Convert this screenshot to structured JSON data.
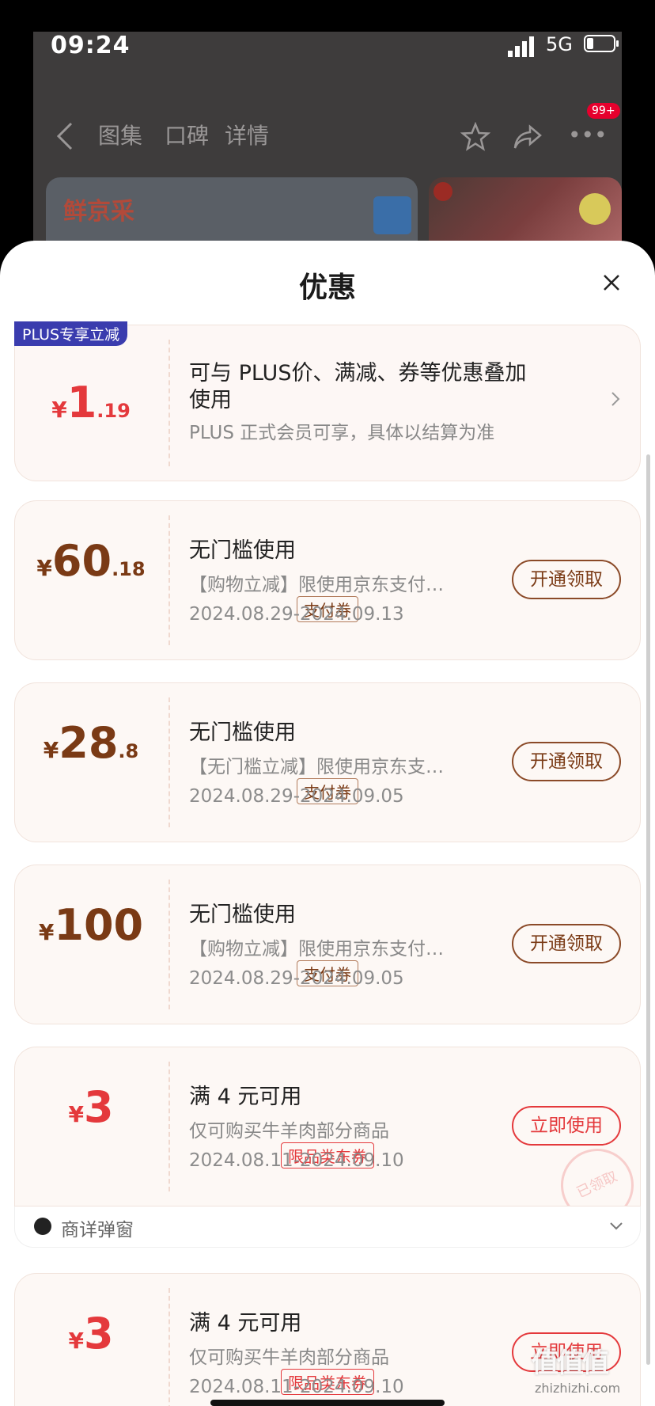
{
  "status": {
    "time": "09:24",
    "network": "5G"
  },
  "topnav": {
    "tabs": [
      "图集",
      "口碑",
      "详情"
    ],
    "badge": "99+"
  },
  "background": {
    "brand": "鲜京采"
  },
  "sheet": {
    "title": "优惠"
  },
  "plus_promo": {
    "badge": "PLUS专享立减",
    "amount_int": "1",
    "amount_dec": ".19",
    "title_line1": "可与 PLUS价、满减、券等优惠叠加",
    "title_line2": "使用",
    "note": "PLUS 正式会员可享，具体以结算为准"
  },
  "coupons": [
    {
      "int": "60",
      "dec": ".18",
      "tag": "支付券",
      "title": "无门槛使用",
      "desc": "【购物立减】限使用京东支付…",
      "date": "2024.08.29-2024.09.13",
      "button": "开通领取"
    },
    {
      "int": "28",
      "dec": ".8",
      "tag": "支付券",
      "title": "无门槛使用",
      "desc": "【无门槛立减】限使用京东支…",
      "date": "2024.08.29-2024.09.05",
      "button": "开通领取"
    },
    {
      "int": "100",
      "dec": "",
      "tag": "支付券",
      "title": "无门槛使用",
      "desc": "【购物立减】限使用京东支付…",
      "date": "2024.08.29-2024.09.05",
      "button": "开通领取"
    },
    {
      "int": "3",
      "dec": "",
      "tag": "限品类东券",
      "title": "满 4 元可用",
      "desc": "仅可购买牛羊肉部分商品",
      "date": "2024.08.11-2024.09.10",
      "button": "立即使用",
      "stamp": "已领取"
    },
    {
      "int": "3",
      "dec": "",
      "tag": "限品类东券",
      "title": "满 4 元可用",
      "desc": "仅可购买牛羊肉部分商品",
      "date": "2024.08.11-2024.09.10",
      "button": "立即使用"
    }
  ],
  "footer": {
    "label": "商详弹窗"
  },
  "currency": "¥",
  "watermark": {
    "logo": "值值值",
    "site": "zhizhizhi.com"
  },
  "colors": {
    "price_brown": "#7a3a15",
    "price_red": "#e4393c",
    "plus_badge": "#3a3cae"
  }
}
